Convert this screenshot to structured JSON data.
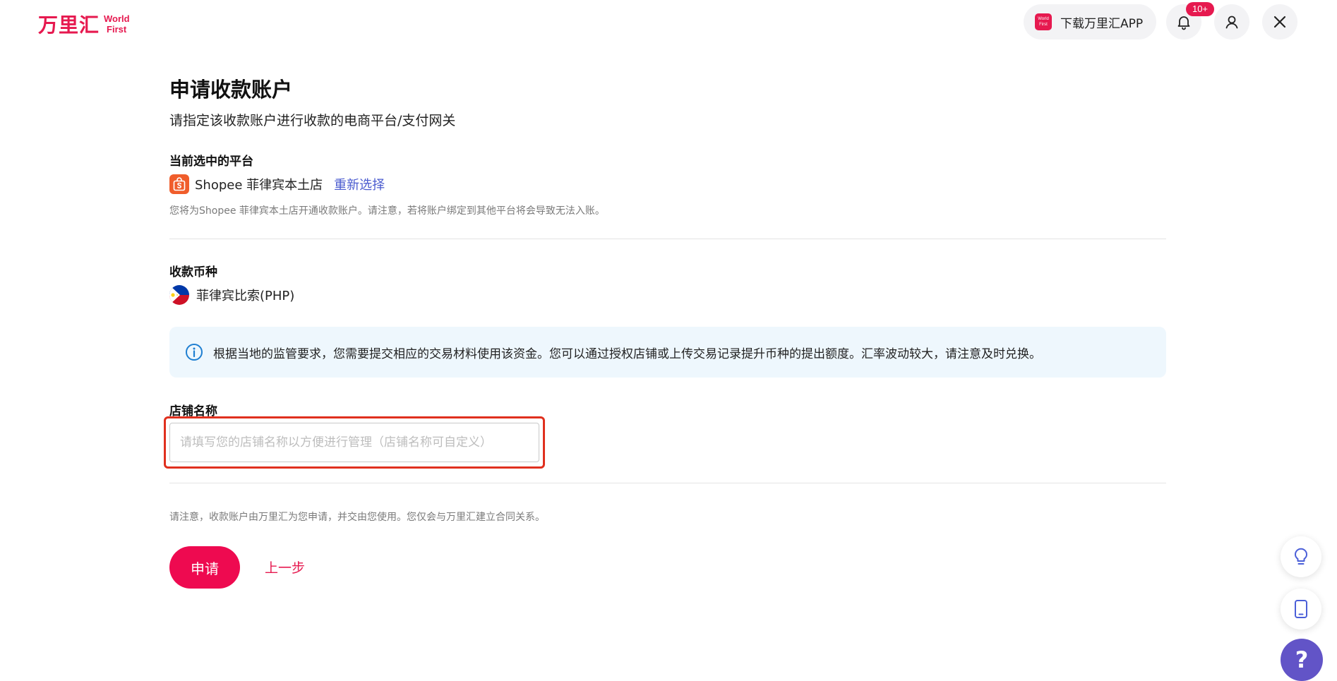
{
  "header": {
    "logo_cn": "万里汇",
    "logo_en_line1": "World",
    "logo_en_line2": "First",
    "app_icon_text_1": "World",
    "app_icon_text_2": "First",
    "download_app_label": "下载万里汇APP",
    "notification_badge": "10+"
  },
  "page": {
    "title": "申请收款账户",
    "subtitle": "请指定该收款账户进行收款的电商平台/支付网关"
  },
  "platform_section": {
    "label": "当前选中的平台",
    "platform_name": "Shopee 菲律宾本土店",
    "reselect_label": "重新选择",
    "hint": "您将为Shopee 菲律宾本土店开通收款账户。请注意，若将账户绑定到其他平台将会导致无法入账。"
  },
  "currency_section": {
    "label": "收款币种",
    "currency_name": "菲律宾比索(PHP)"
  },
  "notice": {
    "text": "根据当地的监管要求，您需要提交相应的交易材料使用该资金。您可以通过授权店铺或上传交易记录提升币种的提出额度。汇率波动较大，请注意及时兑换。"
  },
  "store_section": {
    "label": "店铺名称",
    "input_value": "",
    "input_placeholder": "请填写您的店铺名称以方便进行管理（店铺名称可自定义）"
  },
  "footer": {
    "footnote": "请注意，收款账户由万里汇为您申请，并交由您使用。您仅会与万里汇建立合同关系。",
    "apply_label": "申请",
    "back_label": "上一步"
  },
  "floating": {
    "help_label": "?"
  },
  "colors": {
    "brand": "#e6194f",
    "apply_button": "#ee0a50",
    "link_blue": "#4a5bcf",
    "notice_bg": "#eef7fd",
    "highlight_border": "#e0301e",
    "help_purple": "#6254c7"
  },
  "icons": [
    "bell-icon",
    "user-icon",
    "close-icon",
    "shopee-icon",
    "philippines-flag-icon",
    "info-icon",
    "lightbulb-icon",
    "mobile-icon",
    "help-icon"
  ]
}
